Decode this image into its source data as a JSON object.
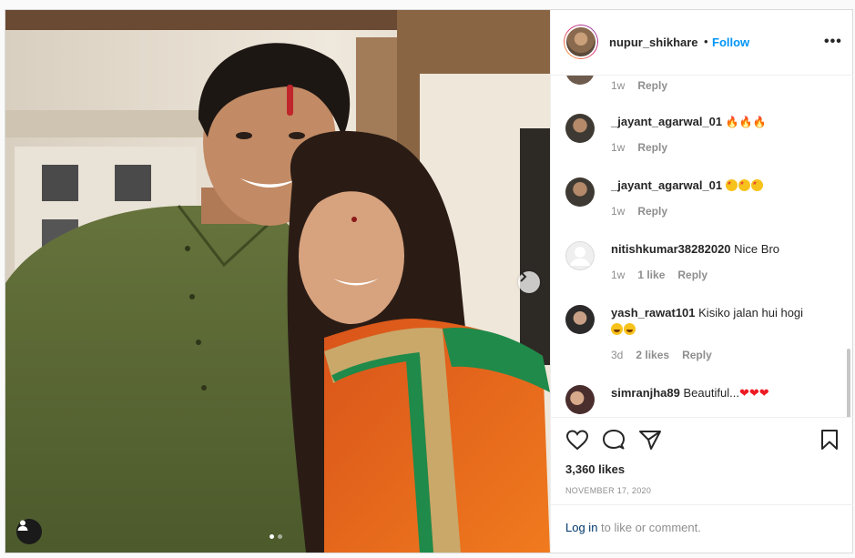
{
  "post": {
    "username": "nupur_shikhare",
    "separator": "•",
    "follow_label": "Follow",
    "more_label": "•••",
    "carousel_total": 2,
    "carousel_active": 1
  },
  "comments": [
    {
      "user": "",
      "text": "",
      "time": "1w",
      "likes": "",
      "reply": "Reply"
    },
    {
      "user": "_jayant_agarwal_01",
      "text": "",
      "emoji": "fire",
      "time": "1w",
      "likes": "",
      "reply": "Reply"
    },
    {
      "user": "_jayant_agarwal_01",
      "text": "",
      "emoji": "star-eyes",
      "time": "1w",
      "likes": "",
      "reply": "Reply"
    },
    {
      "user": "nitishkumar38282020",
      "text": "Nice Bro",
      "time": "1w",
      "likes": "1 like",
      "reply": "Reply"
    },
    {
      "user": "yash_rawat101",
      "text": "Kisiko jalan hui hogi",
      "emoji": "laugh",
      "time": "3d",
      "likes": "2 likes",
      "reply": "Reply"
    },
    {
      "user": "simranjha89",
      "text": "Beautiful...",
      "emoji": "hearts",
      "time": "",
      "likes": "",
      "reply": ""
    }
  ],
  "actions": {
    "likes": "3,360 likes",
    "date": "NOVEMBER 17, 2020",
    "login_link": "Log in",
    "login_rest": " to like or comment."
  },
  "icons": {
    "like": "heart-outline-icon",
    "comment": "comment-bubble-icon",
    "share": "paper-plane-icon",
    "save": "bookmark-icon",
    "next": "chevron-right-icon",
    "tag": "user-tag-icon"
  },
  "colors": {
    "accent": "#0095f6",
    "muted": "#8e8e8e",
    "border": "#dbdbdb",
    "heart": "#ed1b24"
  }
}
